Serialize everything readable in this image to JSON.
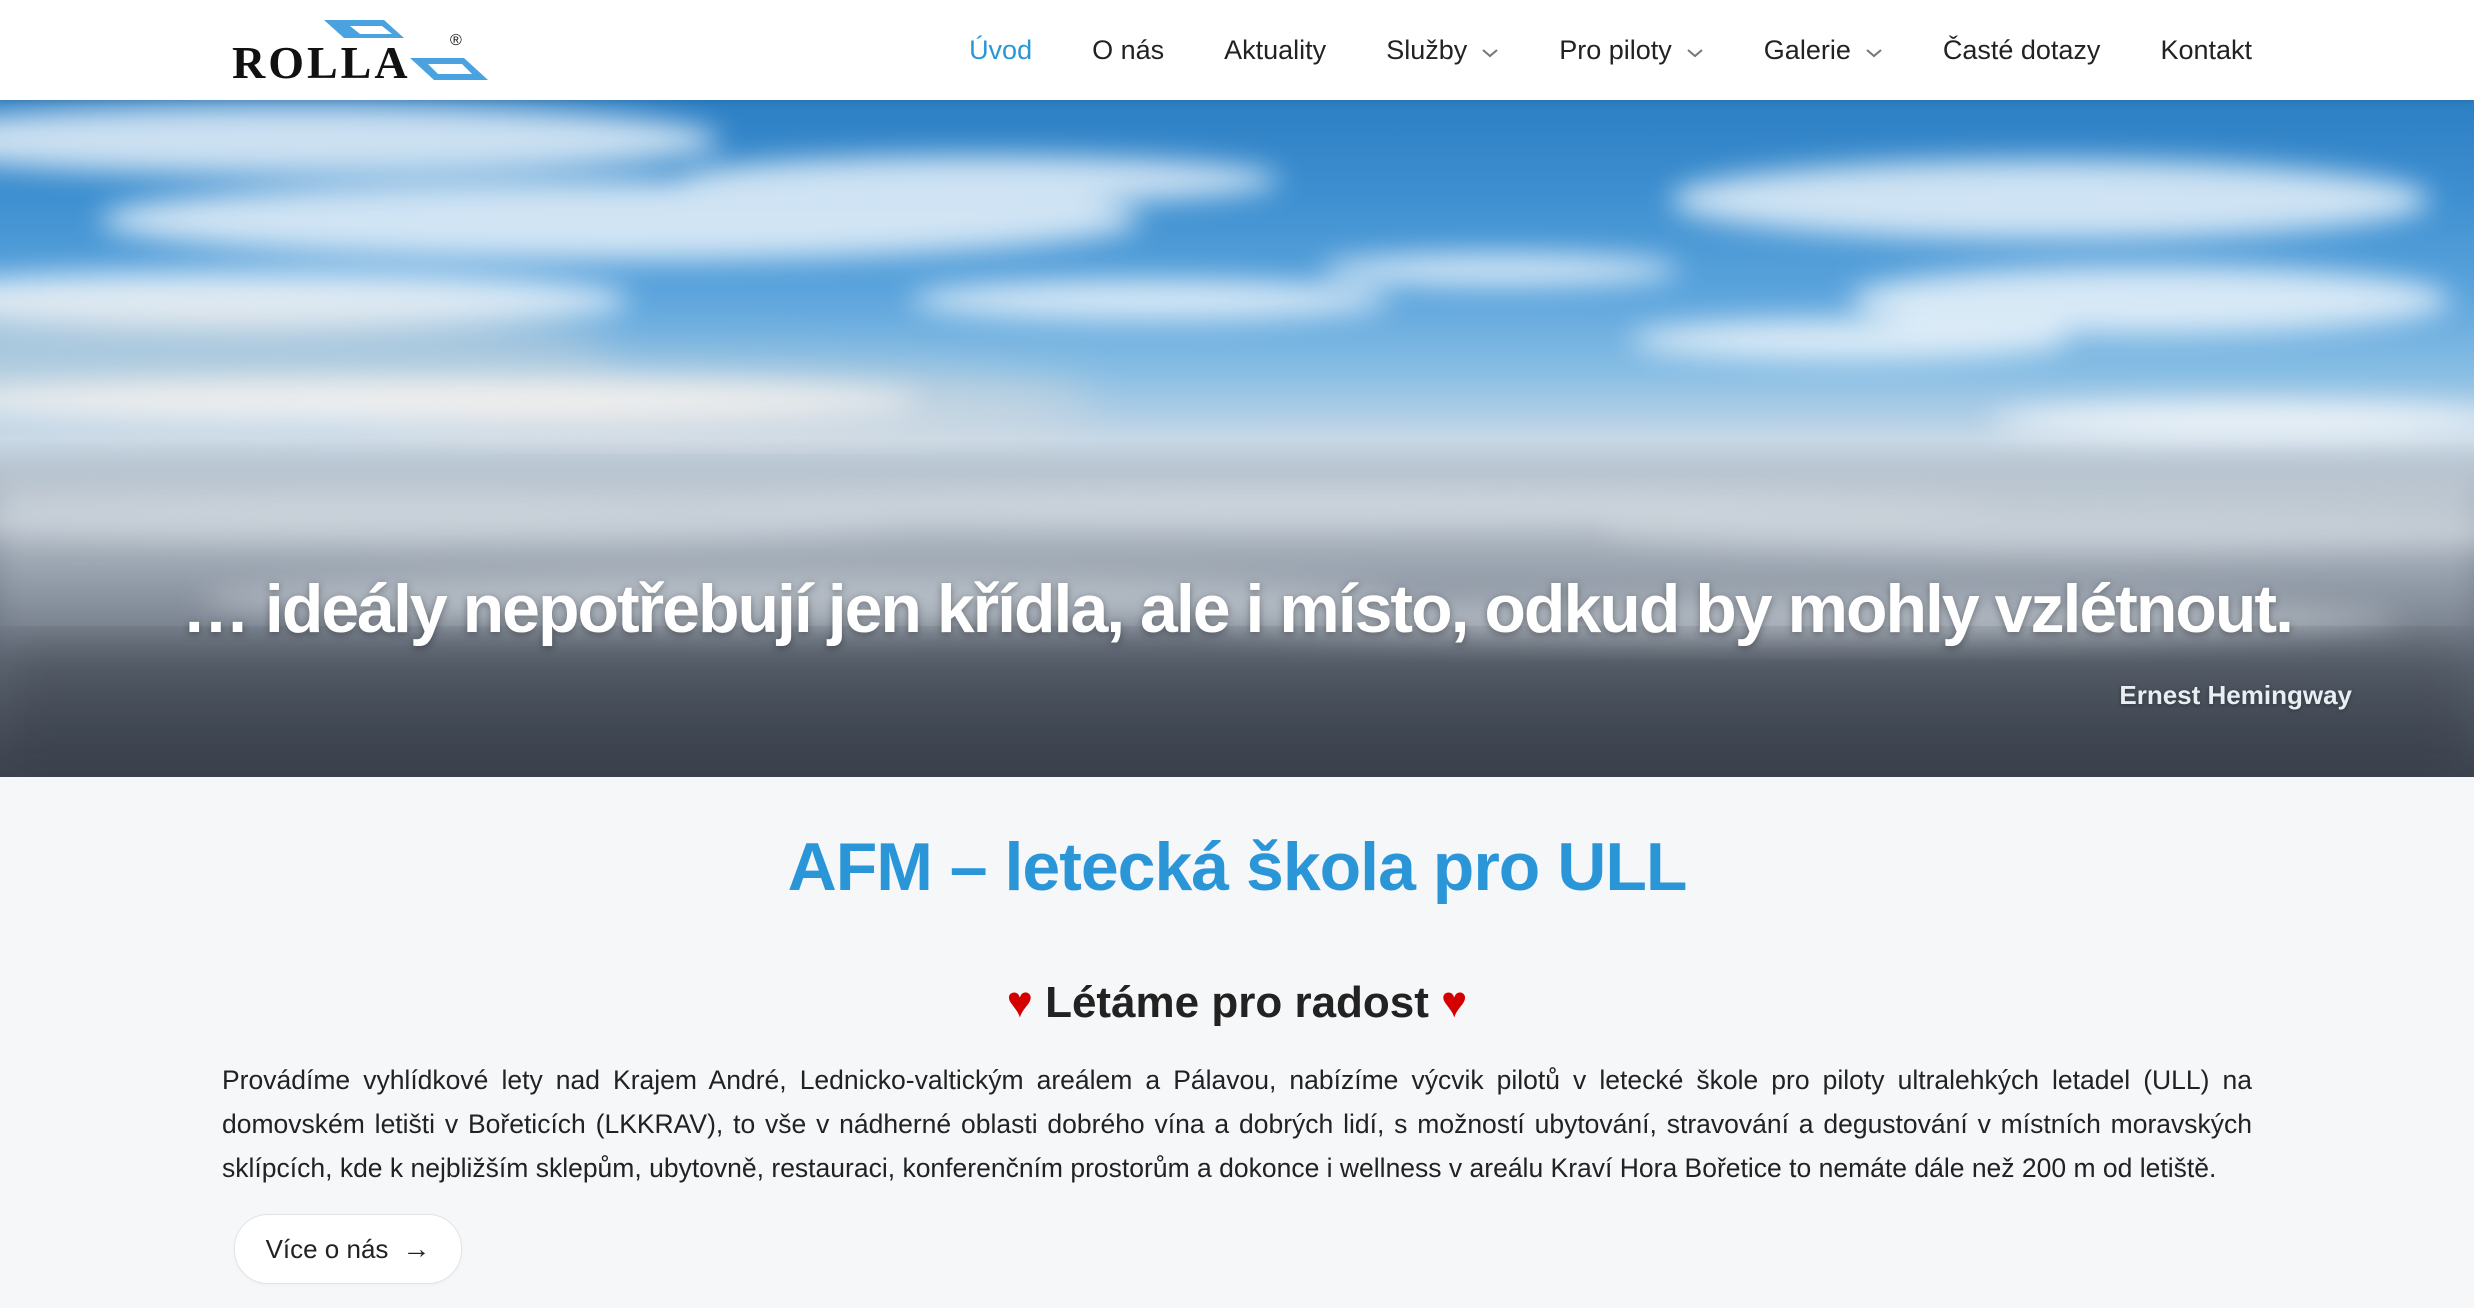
{
  "brand": {
    "logo_text": "ROLLA",
    "logo_mark": "®"
  },
  "nav": {
    "items": [
      {
        "label": "Úvod",
        "active": true,
        "dropdown": false
      },
      {
        "label": "O nás",
        "active": false,
        "dropdown": false
      },
      {
        "label": "Aktuality",
        "active": false,
        "dropdown": false
      },
      {
        "label": "Služby",
        "active": false,
        "dropdown": true
      },
      {
        "label": "Pro piloty",
        "active": false,
        "dropdown": true
      },
      {
        "label": "Galerie",
        "active": false,
        "dropdown": true
      },
      {
        "label": "Časté dotazy",
        "active": false,
        "dropdown": false
      },
      {
        "label": "Kontakt",
        "active": false,
        "dropdown": false
      }
    ]
  },
  "hero": {
    "quote": "… ideály nepotřebují jen křídla, ale i místo, odkud by mohly vzlétnout.",
    "author": "Ernest Hemingway"
  },
  "intro": {
    "title": "AFM – letecká škola pro ULL",
    "subtitle_text": "Létáme pro radost",
    "heart": "♥",
    "paragraph": "Provádíme vyhlídkové lety nad Krajem André, Lednicko-valtickým areálem a Pálavou, nabízíme výcvik pilotů v letecké škole pro piloty ultralehkých letadel (ULL) na domovském letišti v Bořeticích (LKKRAV), to vše v nádherné oblasti dobrého vína a dobrých lidí, s možností ubytování, stravování a degustování v místních moravských sklípcích, kde k nejbližším sklepům, ubytovně, restauraci, konferenčním prostorům a dokonce i wellness v areálu Kraví Hora Bořetice to nemáte dále než 200 m od letiště.",
    "more_button": "Více o nás",
    "more_arrow": "→"
  },
  "colors": {
    "accent": "#2a96d8",
    "heart": "#d40000",
    "text": "#222222",
    "page_bg": "#f6f7f9"
  },
  "icons": {
    "dropdown": "chevron-down-icon",
    "arrow": "arrow-right-icon",
    "heart": "heart-icon"
  }
}
